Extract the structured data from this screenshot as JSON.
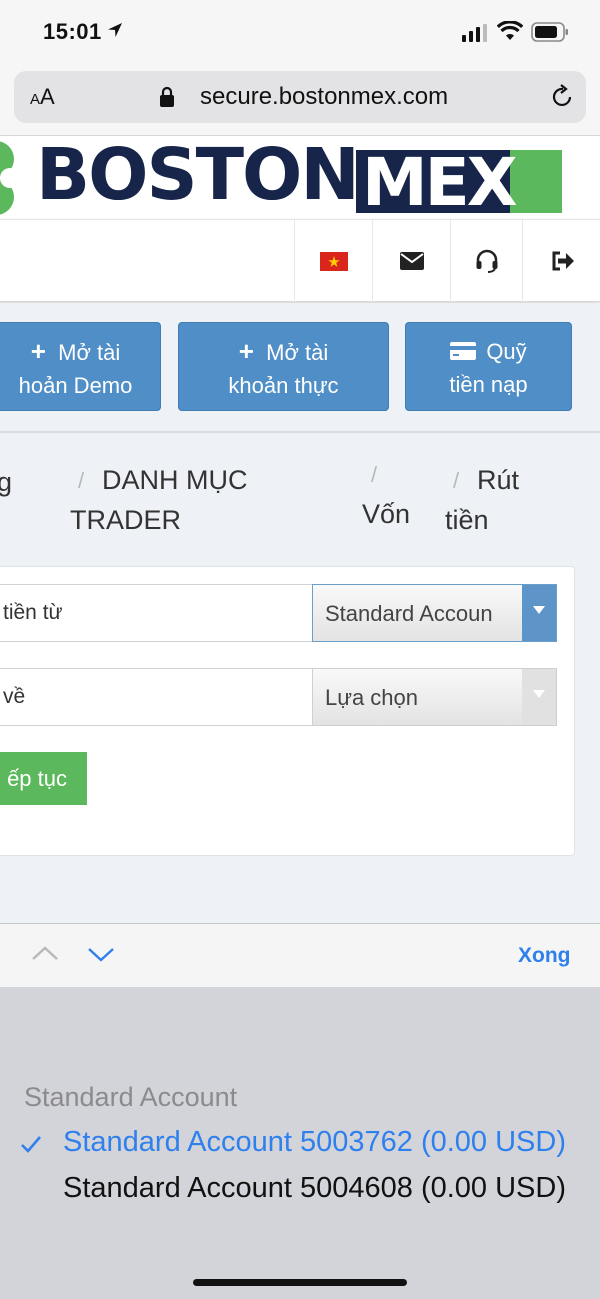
{
  "status_bar": {
    "time": "15:01"
  },
  "browser": {
    "text_size_label": "AA",
    "url": "secure.bostonmex.com"
  },
  "logo": {
    "part1": "BOSTON",
    "part2": "MEX"
  },
  "actions": {
    "demo": {
      "line1": "Mở tài",
      "line2": "hoản Demo"
    },
    "real": {
      "line1": "Mở tài",
      "line2": "khoản thực"
    },
    "fund": {
      "line1": "Quỹ",
      "line2": "tiền nạp"
    }
  },
  "breadcrumb": {
    "item_partial": "g",
    "category_line1": "DANH MỤC",
    "category_line2": "TRADER",
    "capital": "Vốn",
    "withdraw_line1": "Rút",
    "withdraw_line2": "tiền",
    "separator": "/"
  },
  "form": {
    "from_label": "tiền từ",
    "from_value": "Standard Accoun",
    "to_label": "về",
    "to_value": "Lựa chọn",
    "continue_label": "ếp tục"
  },
  "accessory": {
    "done_label": "Xong"
  },
  "picker": {
    "group": "Standard Account",
    "options": [
      {
        "label": "Standard Account 5003762 (0.00 USD)",
        "selected": true
      },
      {
        "label": "Standard Account 5004608 (0.00 USD)",
        "selected": false
      }
    ]
  },
  "colors": {
    "primary_button": "#4f8ec6",
    "success_button": "#5cb85c",
    "brand_navy": "#17254a",
    "ios_blue": "#2f80ed"
  }
}
